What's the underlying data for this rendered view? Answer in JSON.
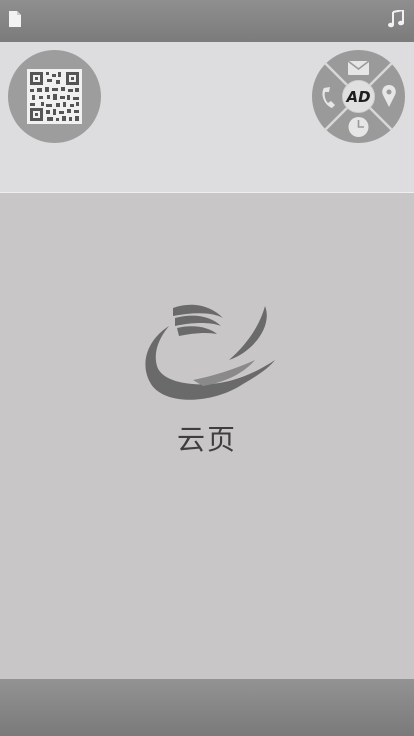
{
  "top_bar": {
    "left_icon": "document-icon",
    "right_icon": "music-note-icon"
  },
  "header": {
    "qr_icon": "qr-code-icon",
    "nav_wheel": {
      "center_icon": "brand-logo-icon",
      "items": [
        "mail-icon",
        "phone-icon",
        "location-pin-icon",
        "clock-icon"
      ]
    }
  },
  "main": {
    "logo_icon": "swoosh-logo-icon",
    "title": "云页"
  },
  "colors": {
    "accent": "#6b6b6b",
    "panel": "#dddddf",
    "background": "#c8c6c6"
  }
}
